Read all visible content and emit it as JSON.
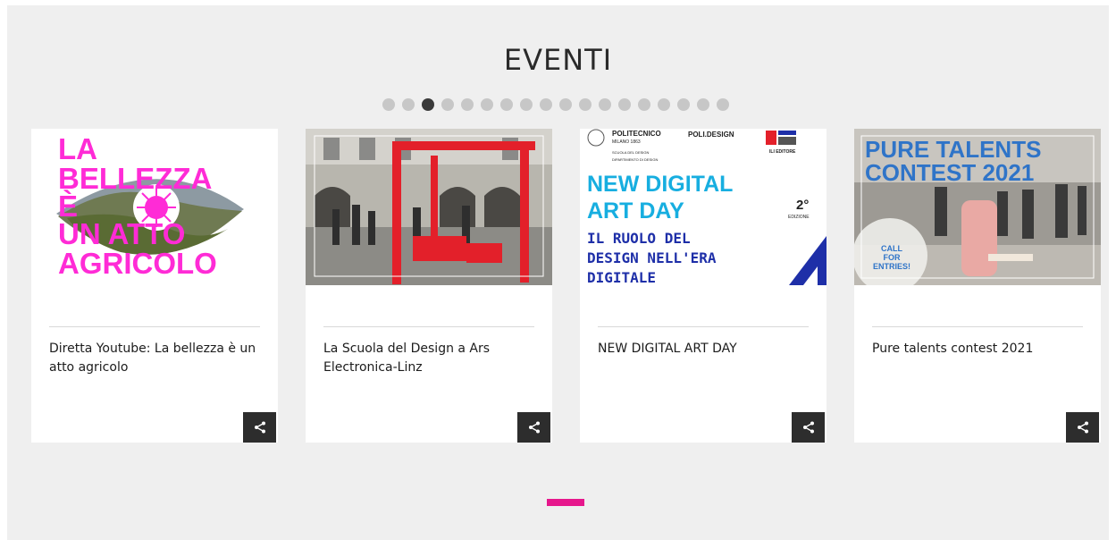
{
  "section": {
    "title": "EVENTI"
  },
  "pagination": {
    "dot_count": 18,
    "active_index": 2
  },
  "cards": [
    {
      "caption": "Diretta Youtube: La bellezza è un atto agricolo",
      "image": {
        "lines": [
          "LA",
          "BELLEZZA",
          "È",
          "UN ATTO",
          "AGRICOLO"
        ],
        "text_color": "#ff2bd6"
      }
    },
    {
      "caption": "La Scuola del Design a Ars Electronica-Linz",
      "image": {
        "accent": "#e3202a"
      }
    },
    {
      "caption": "NEW DIGITAL ART DAY",
      "image": {
        "logo_1": "POLITECNICO",
        "logo_1_sub": "MILANO 1863",
        "logo_1_dept": "SCUOLA DEL DESIGN",
        "logo_1_dept2": "DIPARTIMENTO DI DESIGN",
        "logo_2": "POLI.DESIGN",
        "logo_3": "ILI EDITORE",
        "headline": [
          "NEW DIGITAL",
          "ART DAY"
        ],
        "edition": "2°",
        "edition_label": "EDIZIONE",
        "subhead": [
          "IL RUOLO DEL",
          "DESIGN NELL'ERA",
          "DIGITALE"
        ],
        "headline_color": "#17aee0",
        "subhead_color": "#1e2fa8"
      }
    },
    {
      "caption": "Pure talents contest 2021",
      "image": {
        "headline": [
          "PURE TALENTS",
          "CONTEST 2021"
        ],
        "badge": [
          "CALL",
          "FOR",
          "ENTRIES!"
        ],
        "headline_color": "#2f74c8"
      }
    }
  ],
  "share_icon": "share-icon",
  "active_indicator_color": "#e6178c"
}
